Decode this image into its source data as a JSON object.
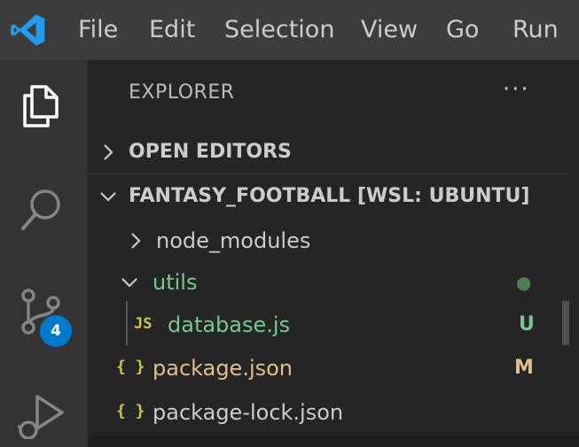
{
  "app": {
    "logo_icon": "vscode-logo-icon",
    "accent_color": "#007acc"
  },
  "menu": {
    "items": [
      {
        "label": "File"
      },
      {
        "label": "Edit"
      },
      {
        "label": "Selection"
      },
      {
        "label": "View"
      },
      {
        "label": "Go"
      },
      {
        "label": "Run"
      }
    ]
  },
  "activity_bar": {
    "explorer_icon": "files-icon",
    "search_icon": "search-icon",
    "source_control_icon": "source-control-icon",
    "source_control_badge": "4",
    "run_debug_icon": "run-debug-icon"
  },
  "sidebar": {
    "title": "EXPLORER",
    "more_actions": "···",
    "sections": {
      "open_editors": {
        "label": "OPEN EDITORS",
        "expanded": false
      },
      "workspace": {
        "label": "FANTASY_FOOTBALL [WSL: UBUNTU]",
        "expanded": true
      }
    },
    "tree": [
      {
        "name": "node_modules",
        "type": "folder",
        "expanded": false,
        "status": "",
        "color": "#cccccc"
      },
      {
        "name": "utils",
        "type": "folder",
        "expanded": true,
        "status": "●",
        "color": "#73c991",
        "status_color": "#4e7f52"
      },
      {
        "name": "database.js",
        "type": "js",
        "icon": "JS",
        "status": "U",
        "color": "#73c991",
        "status_color": "#73c991",
        "icon_color": "#cbcb41"
      },
      {
        "name": "package.json",
        "type": "json",
        "icon": "{ }",
        "status": "M",
        "color": "#e2c08d",
        "status_color": "#e2c08d",
        "icon_color": "#cbcb41"
      },
      {
        "name": "package-lock.json",
        "type": "json",
        "icon": "{ }",
        "status": "",
        "color": "#cccccc",
        "icon_color": "#cbcb41"
      }
    ]
  }
}
